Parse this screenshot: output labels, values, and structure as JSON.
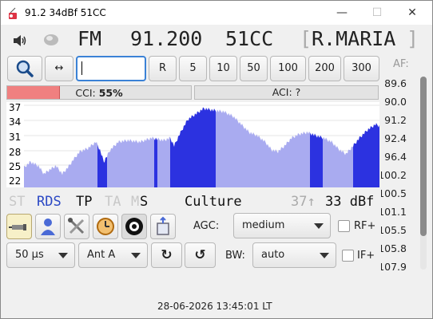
{
  "window": {
    "title": "91.2 34dBf 51CC",
    "minimize": "—",
    "maximize": "☐",
    "close": "✕"
  },
  "header": {
    "band": "FM",
    "frequency": "91.200",
    "pi": "51CC",
    "ps_open": "[",
    "ps": "R.MARIA",
    "ps_close": "]"
  },
  "toolbar": {
    "search_input_value": "",
    "swap_label": "↔",
    "steps": [
      "R",
      "5",
      "10",
      "50",
      "100",
      "200",
      "300"
    ],
    "af_label": "AF:"
  },
  "meters": {
    "cci_label": "CCI:",
    "cci_value": "55%",
    "cci_level": 0.55,
    "aci_label": "ACI:",
    "aci_value": "?"
  },
  "spectrum": {
    "y_ticks": [
      "37",
      "34",
      "31",
      "28",
      "25",
      "22"
    ],
    "fill_color": "#a9abf0",
    "highlight_color": "#2c32e0"
  },
  "af_list": [
    "89.6",
    "90.0",
    "91.2",
    "92.4",
    "96.4",
    "100.2",
    "100.5",
    "101.1",
    "105.5",
    "105.8",
    "107.9"
  ],
  "status": {
    "st": "ST",
    "rds": "RDS",
    "tp": "TP",
    "ta": "TA",
    "m": "M",
    "s": "S",
    "pty": "Culture",
    "signal_extra": "37↑",
    "signal": "33 dBf"
  },
  "controls": {
    "agc_label": "AGC:",
    "agc_value": "medium",
    "rf_label": "RF+",
    "bw_label": "BW:",
    "bw_value": "auto",
    "if_label": "IF+",
    "deemphasis_value": "50 µs",
    "antenna_value": "Ant A",
    "rotate_cw": "↻",
    "rotate_ccw": "↺"
  },
  "footer": {
    "datetime": "28-06-2026 13:45:01 LT"
  }
}
